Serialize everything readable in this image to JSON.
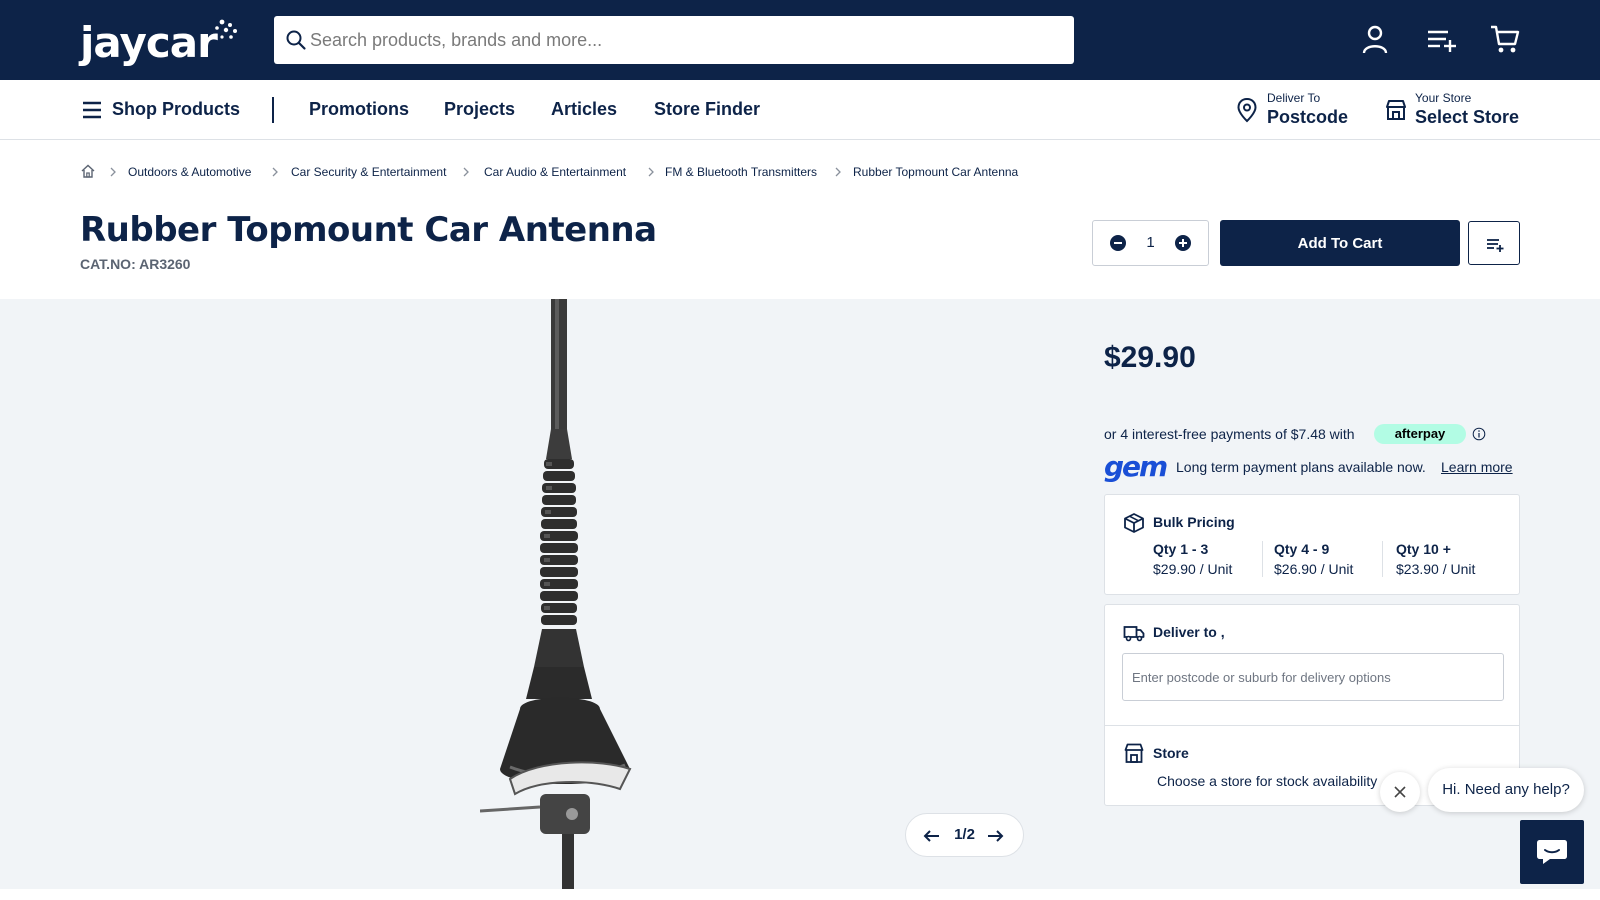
{
  "brand": {
    "logo_text": "jaycar"
  },
  "search": {
    "placeholder": "Search products, brands and more..."
  },
  "nav": {
    "shop_products": "Shop Products",
    "links": [
      "Promotions",
      "Projects",
      "Articles",
      "Store Finder"
    ],
    "deliver": {
      "small": "Deliver To",
      "big": "Postcode"
    },
    "store": {
      "small": "Your Store",
      "big": "Select Store"
    }
  },
  "breadcrumbs": [
    "Outdoors & Automotive",
    "Car Security & Entertainment",
    "Car Audio & Entertainment",
    "FM & Bluetooth Transmitters",
    "Rubber Topmount Car Antenna"
  ],
  "product": {
    "title": "Rubber Topmount Car Antenna",
    "catno": "CAT.NO: AR3260",
    "quantity": "1",
    "add_to_cart": "Add To Cart",
    "price": "$29.90"
  },
  "gallery": {
    "pager": "1/2"
  },
  "payments": {
    "afterpay_text": "or 4 interest-free payments of $7.48 with",
    "afterpay_badge": "afterpay",
    "gem_logo": "gem",
    "gem_text": "Long term payment plans available now.",
    "gem_link": "Learn more"
  },
  "bulk": {
    "title": "Bulk Pricing",
    "tiers": [
      {
        "qty": "Qty 1 - 3",
        "price": "$29.90 / Unit"
      },
      {
        "qty": "Qty 4 - 9",
        "price": "$26.90 / Unit"
      },
      {
        "qty": "Qty 10 +",
        "price": "$23.90 / Unit"
      }
    ]
  },
  "delivery": {
    "title": "Deliver to ,",
    "placeholder": "Enter postcode or suburb for delivery options"
  },
  "store_card": {
    "title": "Store",
    "subtitle": "Choose a store for stock availability"
  },
  "chat": {
    "bubble": "Hi. Need any help?"
  },
  "colors": {
    "navy": "#0d2348",
    "afterpay": "#b2fce4",
    "gem": "#1a4fd6",
    "gallery_bg": "#f1f4f7"
  }
}
